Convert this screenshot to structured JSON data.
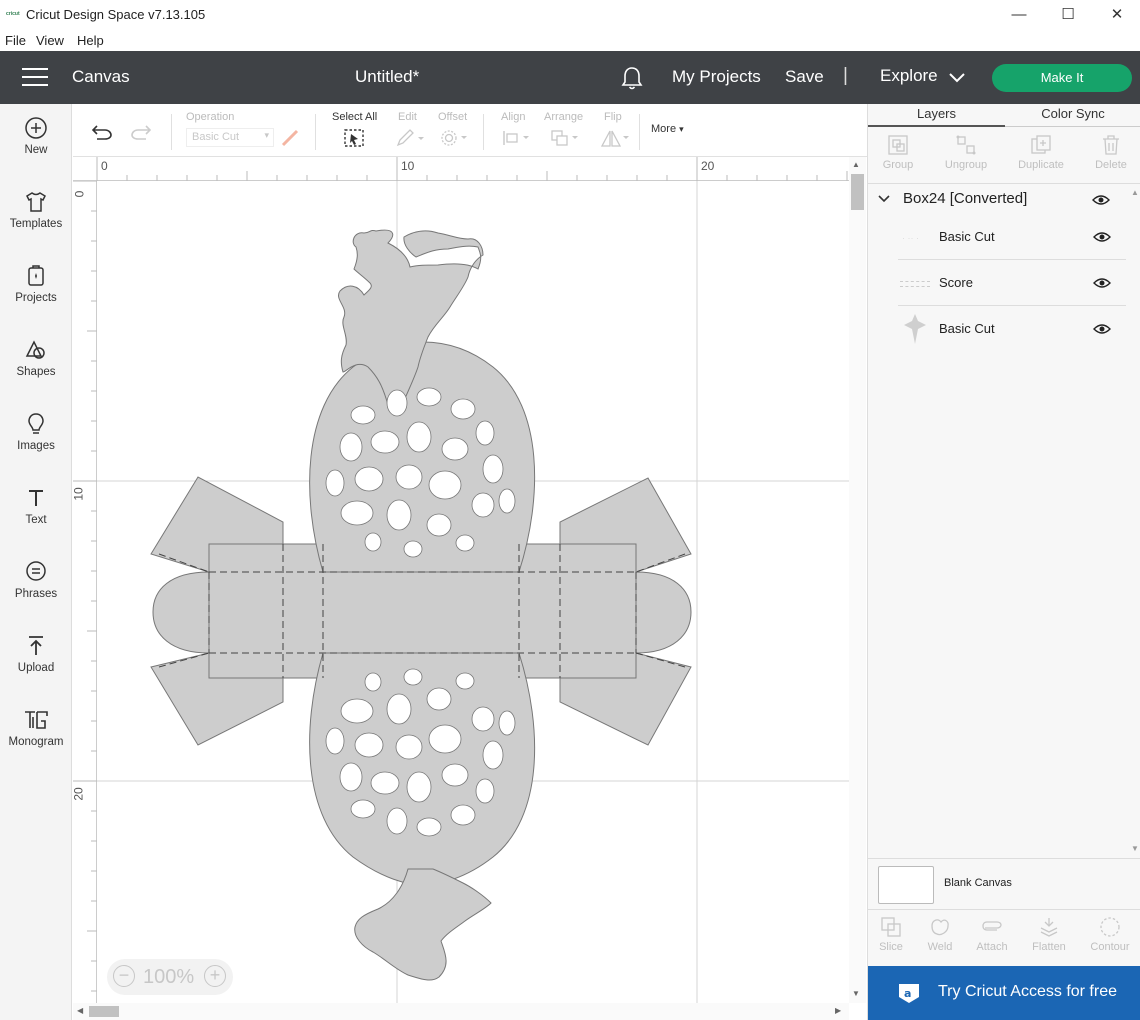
{
  "window": {
    "app_title": "Cricut Design Space  v7.13.105",
    "logo_text": "cricut",
    "minimize": "—",
    "maximize": "☐",
    "close": "✕"
  },
  "menu": {
    "file": "File",
    "view": "View",
    "help": "Help"
  },
  "header": {
    "section": "Canvas",
    "document_title": "Untitled*",
    "my_projects": "My Projects",
    "save": "Save",
    "separator": "|",
    "explore": "Explore",
    "make_it": "Make It",
    "brand_color": "#16a36a",
    "bar_color": "#3f4246"
  },
  "sidebar": {
    "items": [
      {
        "label": "New",
        "icon": "plus-circle-icon"
      },
      {
        "label": "Templates",
        "icon": "tshirt-icon"
      },
      {
        "label": "Projects",
        "icon": "projects-icon"
      },
      {
        "label": "Shapes",
        "icon": "shapes-icon"
      },
      {
        "label": "Images",
        "icon": "lightbulb-icon"
      },
      {
        "label": "Text",
        "icon": "text-icon"
      },
      {
        "label": "Phrases",
        "icon": "speech-bubble-icon"
      },
      {
        "label": "Upload",
        "icon": "upload-icon"
      },
      {
        "label": "Monogram",
        "icon": "monogram-icon"
      }
    ]
  },
  "toolbar": {
    "operation_label": "Operation",
    "operation_value": "Basic Cut",
    "select_all": "Select All",
    "edit": "Edit",
    "offset": "Offset",
    "align": "Align",
    "arrange": "Arrange",
    "flip": "Flip",
    "more": "More"
  },
  "canvas": {
    "ruler_top": [
      "0",
      "10",
      "20"
    ],
    "ruler_left": [
      "0",
      "10",
      "20"
    ],
    "zoom": "100%",
    "zoom_out": "−",
    "zoom_in": "+"
  },
  "panel": {
    "tabs": [
      "Layers",
      "Color Sync"
    ],
    "tools": [
      "Group",
      "Ungroup",
      "Duplicate",
      "Delete"
    ],
    "group_name": "Box24 [Converted]",
    "layers": [
      {
        "name": "Basic Cut"
      },
      {
        "name": "Score"
      },
      {
        "name": "Basic Cut"
      }
    ],
    "blank_canvas": "Blank Canvas",
    "bottom_tools": [
      "Slice",
      "Weld",
      "Attach",
      "Flatten",
      "Contour"
    ],
    "access_banner": "Try Cricut Access for free",
    "access_color": "#1b66b4"
  }
}
